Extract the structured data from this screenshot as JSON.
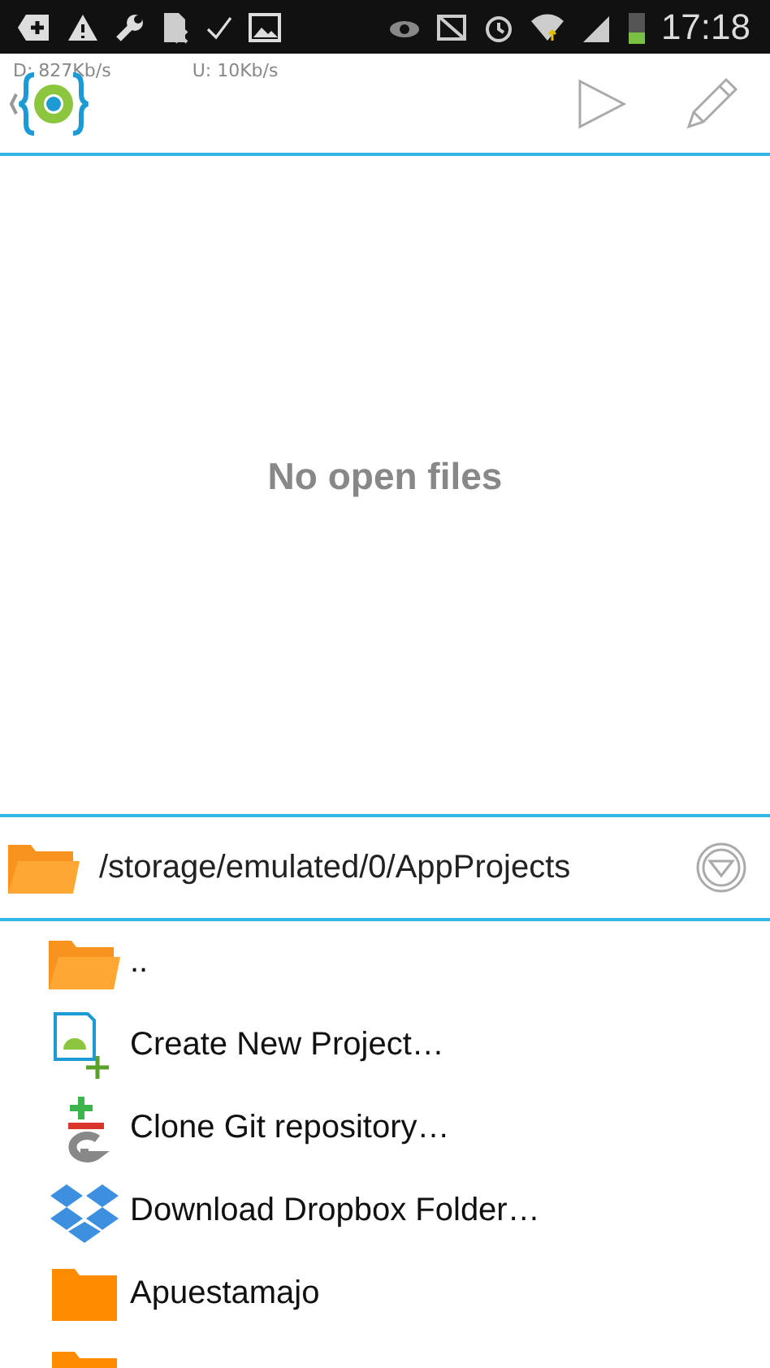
{
  "status_bar": {
    "time": "17:18"
  },
  "toolbar": {
    "download_speed": "D: 827Kb/s",
    "upload_speed": "U: 10Kb/s"
  },
  "editor": {
    "message": "No open files"
  },
  "browser": {
    "path": "/storage/emulated/0/AppProjects",
    "items": [
      {
        "kind": "up",
        "label": ".."
      },
      {
        "kind": "new-project",
        "label": "Create New Project…"
      },
      {
        "kind": "git",
        "label": "Clone Git repository…"
      },
      {
        "kind": "dropbox",
        "label": "Download Dropbox Folder…"
      },
      {
        "kind": "folder",
        "label": "Apuestamajo"
      },
      {
        "kind": "folder"
      }
    ]
  }
}
